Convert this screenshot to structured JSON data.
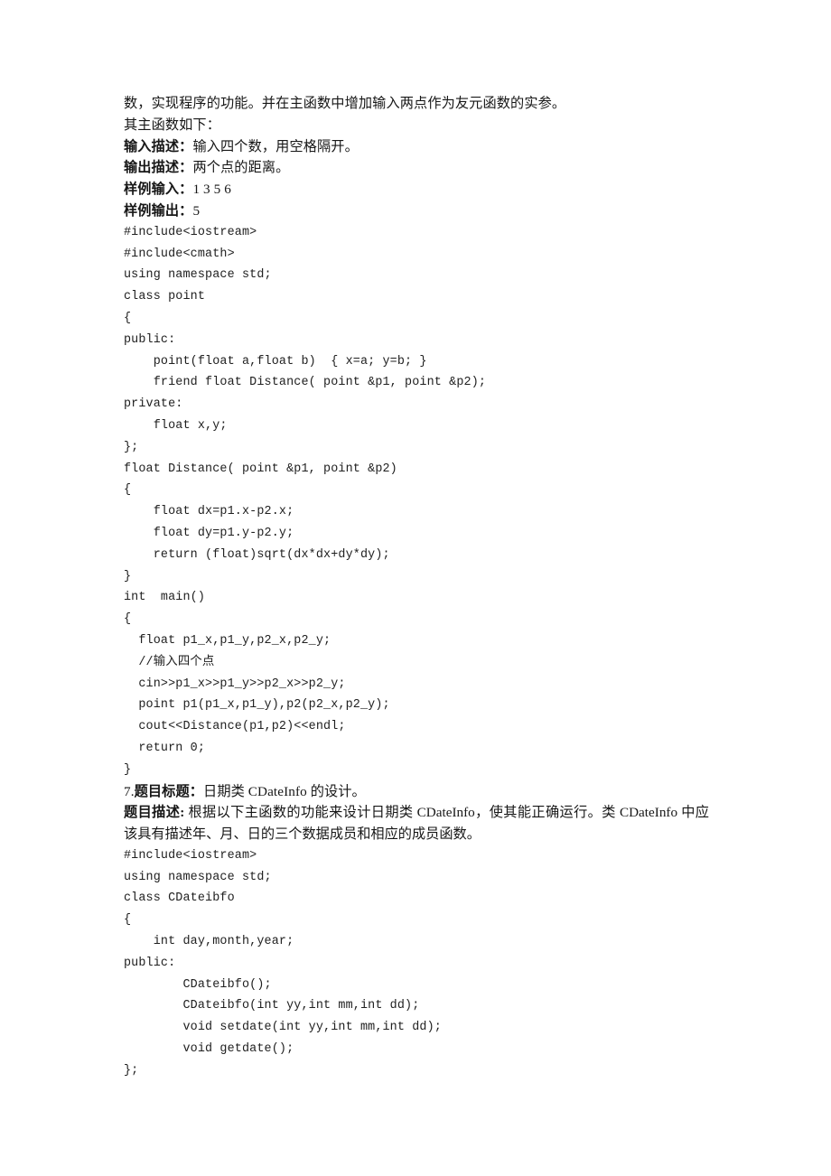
{
  "document": {
    "type": "exam-exercise-document",
    "language": "zh-CN",
    "background_color": "#ffffff",
    "text_color": "#171717"
  },
  "problem6_tail": {
    "intro_line_1": "数，实现程序的功能。并在主函数中增加输入两点作为友元函数的实参。",
    "intro_line_2": "其主函数如下：",
    "input_desc_label": "输入描述：",
    "input_desc_value": "输入四个数，用空格隔开。",
    "output_desc_label": "输出描述：",
    "output_desc_value": "两个点的距离。",
    "sample_input_label": "样例输入：",
    "sample_input_value": "1 3 5 6",
    "sample_output_label": "样例输出：",
    "sample_output_value": "5"
  },
  "code_block_1": {
    "language": "cpp",
    "lines": [
      "#include<iostream>",
      "#include<cmath>",
      "using namespace std;",
      "class point",
      "{",
      "public:",
      "    point(float a,float b)  { x=a; y=b; }",
      "    friend float Distance( point &p1, point &p2);",
      "private:",
      "    float x,y;",
      "};",
      "float Distance( point &p1, point &p2)",
      "{",
      "    float dx=p1.x-p2.x;",
      "    float dy=p1.y-p2.y;",
      "    return (float)sqrt(dx*dx+dy*dy);",
      "}",
      "int  main()",
      "{",
      "  float p1_x,p1_y,p2_x,p2_y;",
      "  //输入四个点",
      "  cin>>p1_x>>p1_y>>p2_x>>p2_y;",
      "  point p1(p1_x,p1_y),p2(p2_x,p2_y);",
      "  cout<<Distance(p1,p2)<<endl;",
      "  return 0;",
      "}"
    ]
  },
  "problem7": {
    "number": "7.",
    "title_label": "题目标题：",
    "title_value": "日期类 CDateInfo 的设计。",
    "desc_label": "题目描述:",
    "desc_value": " 根据以下主函数的功能来设计日期类 CDateInfo，使其能正确运行。类 CDateInfo 中应该具有描述年、月、日的三个数据成员和相应的成员函数。"
  },
  "code_block_2": {
    "language": "cpp",
    "lines": [
      "#include<iostream>",
      "using namespace std;",
      "class CDateibfo",
      "{",
      "    int day,month,year;",
      "public:",
      "        CDateibfo();",
      "        CDateibfo(int yy,int mm,int dd);",
      "        void setdate(int yy,int mm,int dd);",
      "        void getdate();",
      "};"
    ]
  }
}
